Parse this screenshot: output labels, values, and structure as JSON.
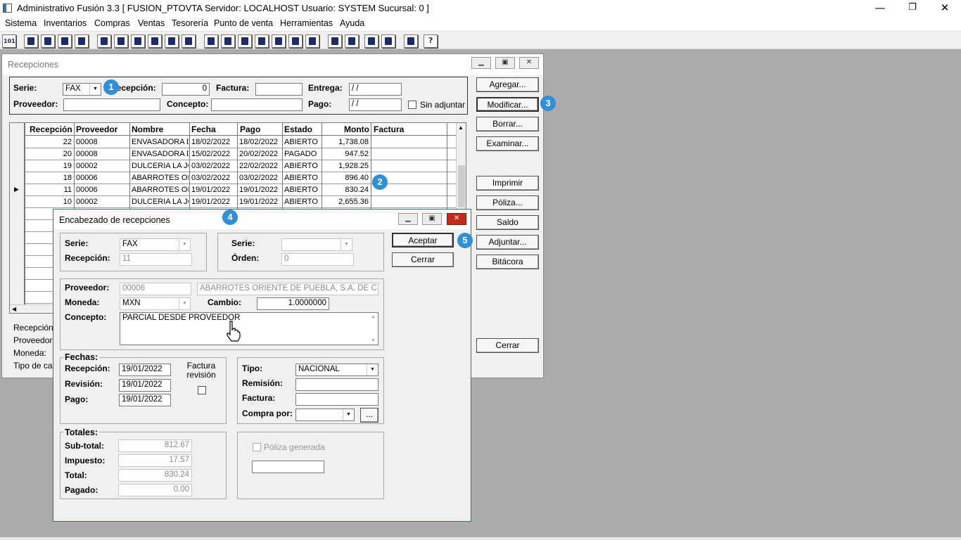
{
  "app": {
    "title": "Administrativo Fusión 3.3 [ FUSION_PTOVTA  Servidor: LOCALHOST  Usuario: SYSTEM    Sucursal: 0 ]",
    "window_buttons": {
      "minimize": "—",
      "restore": "❐",
      "close": "✕"
    }
  },
  "menu": {
    "items": [
      "Sistema",
      "Inventarios",
      "Compras",
      "Ventas",
      "Tesorería",
      "Punto de venta",
      "Herramientas",
      "Ayuda"
    ]
  },
  "toolbar": {
    "icons": [
      "calculator-icon",
      "copy-icon",
      "clipboard-icon",
      "transfer-icon",
      "search-doc-icon",
      "contact-icon",
      "folder-icon",
      "user-edit-icon",
      "print-icon",
      "document-icon",
      "list-icon",
      "binoculars-icon",
      "box-icon",
      "export-icon",
      "add-icon",
      "dollar-icon",
      "page-icon",
      "report-icon",
      "home-icon",
      "zoom-icon",
      "refresh-icon",
      "undo-icon",
      "back-icon",
      "help-icon"
    ],
    "first_label": "101",
    "help_label": "?"
  },
  "recepciones": {
    "title": "Recepciones",
    "filters": {
      "serie_label": "Serie:",
      "serie_value": "FAX",
      "recepcion_label": "Recepción:",
      "recepcion_value": "0",
      "factura_label": "Factura:",
      "factura_value": "",
      "entrega_label": "Entrega:",
      "entrega_value": " / /",
      "proveedor_label": "Proveedor:",
      "proveedor_value": "",
      "concepto_label": "Concepto:",
      "concepto_value": "",
      "pago_label": "Pago:",
      "pago_value": " / /",
      "sin_adjuntar_label": "Sin adjuntar",
      "sin_adjuntar_checked": false
    },
    "columns": [
      "Recepción",
      "Proveedor",
      "Nombre",
      "Fecha",
      "Pago",
      "Estado",
      "Monto",
      "Factura"
    ],
    "rows": [
      {
        "recepcion": "22",
        "proveedor": "00008",
        "nombre": "ENVASADORA D",
        "fecha": "18/02/2022",
        "pago": "18/02/2022",
        "estado": "ABIERTO",
        "monto": "1,738.08",
        "factura": "",
        "current": false
      },
      {
        "recepcion": "20",
        "proveedor": "00008",
        "nombre": "ENVASADORA D",
        "fecha": "15/02/2022",
        "pago": "20/02/2022",
        "estado": "PAGADO",
        "monto": "947.52",
        "factura": "",
        "current": false
      },
      {
        "recepcion": "19",
        "proveedor": "00002",
        "nombre": "DULCERIA LA JC",
        "fecha": "03/02/2022",
        "pago": "22/02/2022",
        "estado": "ABIERTO",
        "monto": "1,928.25",
        "factura": "",
        "current": false
      },
      {
        "recepcion": "18",
        "proveedor": "00006",
        "nombre": "ABARROTES OR",
        "fecha": "03/02/2022",
        "pago": "03/02/2022",
        "estado": "ABIERTO",
        "monto": "896.40",
        "factura": "",
        "current": false
      },
      {
        "recepcion": "11",
        "proveedor": "00006",
        "nombre": "ABARROTES OR",
        "fecha": "19/01/2022",
        "pago": "19/01/2022",
        "estado": "ABIERTO",
        "monto": "830.24",
        "factura": "",
        "current": true
      },
      {
        "recepcion": "10",
        "proveedor": "00002",
        "nombre": "DULCERIA LA JC",
        "fecha": "19/01/2022",
        "pago": "19/01/2022",
        "estado": "ABIERTO",
        "monto": "2,655.36",
        "factura": "",
        "current": false
      }
    ],
    "current_marker": "▶",
    "buttons": {
      "agregar": "Agregar...",
      "modificar": "Modificar...",
      "borrar": "Borrar...",
      "examinar": "Examinar...",
      "imprimir": "Imprimir",
      "poliza": "Póliza...",
      "saldo": "Saldo",
      "adjuntar": "Adjuntar...",
      "bitacora": "Bitácora",
      "cerrar": "Cerrar"
    },
    "info_labels": [
      "Recepción:",
      "Proveedor:",
      "Moneda:",
      "Tipo de cam"
    ]
  },
  "encabezado": {
    "title": "Encabezado de recepciones",
    "serie_label": "Serie:",
    "serie_value": "FAX",
    "recepcion_label": "Recepción:",
    "recepcion_value": "11",
    "serie2_label": "Serie:",
    "serie2_value": "",
    "orden_label": "Órden:",
    "orden_value": "0",
    "proveedor_label": "Proveedor:",
    "proveedor_code": "00006",
    "proveedor_name": "ABARROTES ORIENTE DE PUEBLA, S.A. DE C.V.",
    "moneda_label": "Moneda:",
    "moneda_value": "MXN",
    "cambio_label": "Cambio:",
    "cambio_value": "1.0000000",
    "concepto_label": "Concepto:",
    "concepto_value": "PARCIAL DESDE PROVEEDOR",
    "fechas": {
      "group_label": "Fechas:",
      "recepcion_label": "Recepción:",
      "recepcion_value": "19/01/2022",
      "revision_label": "Revisión:",
      "revision_value": "19/01/2022",
      "pago_label": "Pago:",
      "pago_value": "19/01/2022",
      "factura_revision_label": "Factura revisión",
      "factura_revision_checked": false
    },
    "tipo_label": "Tipo:",
    "tipo_value": "NACIONAL",
    "remision_label": "Remisión:",
    "remision_value": "",
    "factura_label": "Factura:",
    "factura_value": "",
    "compra_por_label": "Compra por:",
    "compra_por_value": "",
    "ellipsis_label": "...",
    "totales": {
      "group_label": "Totales:",
      "subtotal_label": "Sub-total:",
      "subtotal_value": "812.67",
      "impuesto_label": "Impuesto:",
      "impuesto_value": "17.57",
      "total_label": "Total:",
      "total_value": "830.24",
      "pagado_label": "Pagado:",
      "pagado_value": "0.00"
    },
    "poliza_generada_label": "Póliza generada",
    "poliza_generada_checked": false,
    "poliza_value": "",
    "aceptar": "Aceptar",
    "cerrar": "Cerrar"
  },
  "badges": [
    "1",
    "2",
    "3",
    "4",
    "5"
  ],
  "colors": {
    "badge": "#2f8fd8",
    "desktop": "#ababab",
    "toolbar_icon": "#1b2a6b"
  }
}
